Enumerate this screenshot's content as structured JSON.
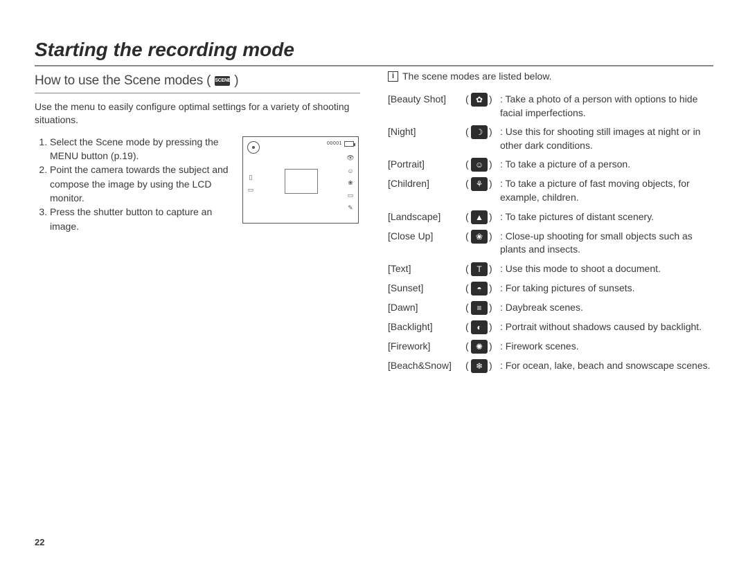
{
  "page_number": "22",
  "title": "Starting the recording mode",
  "left": {
    "subhead": "How to use the Scene modes (",
    "subhead_badge": "SCENE",
    "subhead_close": ")",
    "intro": "Use the menu to easily conﬁgure optimal settings for a variety of shooting situations.",
    "steps": [
      "Select the Scene mode by pressing the MENU button (p.19).",
      "Point the camera towards the subject and compose the image by using the LCD monitor.",
      "Press the shutter button to capture an image."
    ],
    "lcd_counter": "00001"
  },
  "right": {
    "list_head": "The scene modes are listed below.",
    "modes": [
      {
        "name": "[Beauty Shot]",
        "glyph": "✿",
        "desc": "Take a photo of a person with options to hide facial imperfections."
      },
      {
        "name": "[Night]",
        "glyph": "☽",
        "desc": "Use this for shooting still images at night or in other dark conditions."
      },
      {
        "name": "[Portrait]",
        "glyph": "☺",
        "desc": "To take a picture of a person."
      },
      {
        "name": "[Children]",
        "glyph": "⚘",
        "desc": "To take a picture of fast moving objects, for example, children."
      },
      {
        "name": "[Landscape]",
        "glyph": "▲",
        "desc": "To take pictures of distant scenery."
      },
      {
        "name": "[Close Up]",
        "glyph": "❀",
        "desc": "Close-up shooting for small objects such as plants and insects."
      },
      {
        "name": "[Text]",
        "glyph": "T",
        "desc": "Use this mode to shoot a document."
      },
      {
        "name": "[Sunset]",
        "glyph": "◓",
        "desc": "For taking pictures of sunsets."
      },
      {
        "name": "[Dawn]",
        "glyph": "≡",
        "desc": "Daybreak scenes."
      },
      {
        "name": "[Backlight]",
        "glyph": "◐",
        "desc": "Portrait without shadows caused by backlight."
      },
      {
        "name": "[Firework]",
        "glyph": "✺",
        "desc": "Firework scenes."
      },
      {
        "name": "[Beach&Snow]",
        "glyph": "❄",
        "desc": "For ocean, lake, beach and snowscape scenes."
      }
    ]
  }
}
